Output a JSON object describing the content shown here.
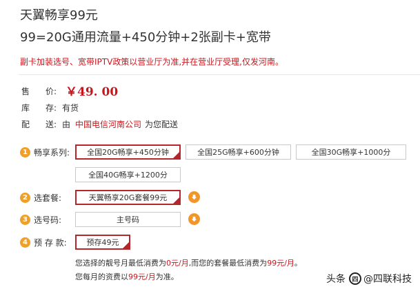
{
  "product": {
    "title": "天翼畅享99元",
    "subtitle": "99=20G通用流量+450分钟+2张副卡+宽带",
    "notice": "副卡加装选号、宽带IPTV政策以营业厅为准,并在营业厅受理,仅发河南。"
  },
  "price_row": {
    "label_a": "售",
    "label_b": "价:",
    "value": "￥49. 00"
  },
  "stock_row": {
    "label_a": "库",
    "label_b": "存:",
    "value": "有货"
  },
  "ship_row": {
    "label_a": "配",
    "label_b": "送:",
    "prefix": "由",
    "seller": "中国电信河南公司",
    "suffix": "为您配送"
  },
  "steps": [
    {
      "num": "1",
      "label": "畅享系列:"
    },
    {
      "num": "2",
      "label": "选套餐:"
    },
    {
      "num": "3",
      "label": "选号码:"
    },
    {
      "num": "4",
      "label": "预 存 款:"
    }
  ],
  "series_options": [
    "全国20G畅享+450分钟",
    "全国25G畅享+600分钟",
    "全国30G畅享+1000分",
    "全国40G畅享+1200分"
  ],
  "selected_series": "全国20G畅享+450分钟",
  "package_option": "天翼畅享20G套餐99元",
  "number_option": "主号码",
  "deposit_option": "预存49元",
  "info": {
    "line1_a": "您选择的靓号月最低消费为",
    "line1_b": "0元/月",
    "line1_c": ",而您的套餐最低消费为",
    "line1_d": "99元/月",
    "line1_e": "。",
    "line2_a": "您每月的资费以",
    "line2_b": "99元/月",
    "line2_c": "为准。"
  },
  "watermark": {
    "prefix": "头条",
    "logo": "四",
    "name": "@四联科技"
  },
  "colors": {
    "accent_red": "#c8161d",
    "step_orange": "#f0a029",
    "selected_border": "#b3262b"
  },
  "icons": {
    "step_badge": "numbered-circle",
    "arrow": "down-arrow-icon"
  }
}
